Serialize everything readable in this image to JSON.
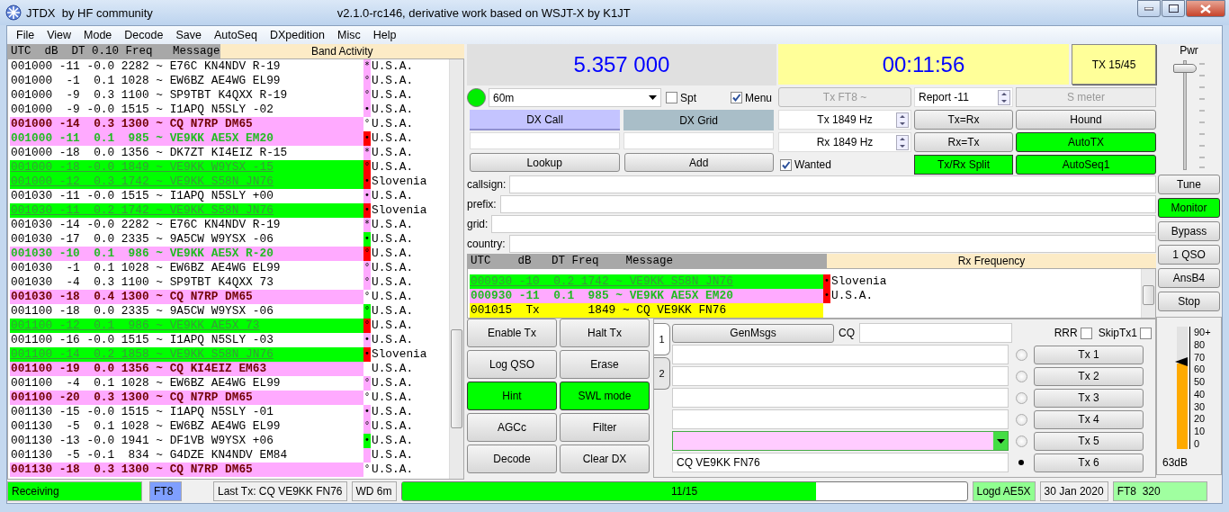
{
  "window": {
    "title": "JTDX  by HF community",
    "subtitle": "v2.1.0-rc146, derivative work based on WSJT-X by K1JT"
  },
  "menu": [
    "File",
    "View",
    "Mode",
    "Decode",
    "Save",
    "AutoSeq",
    "DXpedition",
    "Misc",
    "Help"
  ],
  "band_activity": {
    "header": "UTC  dB  DT 0.10 Freq   Message",
    "title": "Band Activity",
    "rows": [
      {
        "kind": "normal",
        "text": "001000 -11 -0.0 2282 ~ E76C KN4NDV R-19",
        "mark": "*",
        "color": "#ffaaff",
        "country": "U.S.A."
      },
      {
        "kind": "normal",
        "text": "001000  -1  0.1 1028 ~ EW6BZ AE4WG EL99",
        "mark": "°",
        "color": "#ffaaff",
        "country": "U.S.A."
      },
      {
        "kind": "normal",
        "text": "001000  -9  0.3 1100 ~ SP9TBT K4QXX R-19",
        "mark": "°",
        "color": "#ffaaff",
        "country": "U.S.A."
      },
      {
        "kind": "normal",
        "text": "001000  -9 -0.0 1515 ~ I1APQ N5SLY -02",
        "mark": "•",
        "color": "#ffaaff",
        "country": "U.S.A."
      },
      {
        "kind": "cq",
        "text": "001000 -14  0.3 1300 ~ CQ N7RP DM65",
        "mark": "°",
        "color": "#ffffff",
        "country": "U.S.A."
      },
      {
        "kind": "to_me",
        "text": "001000 -11  0.1  985 ~ VE9KK AE5X EM20",
        "mark": "•",
        "color": "#ff0000",
        "country": "U.S.A."
      },
      {
        "kind": "normal",
        "text": "001000 -18  0.0 1356 ~ DK7ZT KI4EIZ R-15",
        "mark": "*",
        "color": "#ffaaff",
        "country": "U.S.A."
      },
      {
        "kind": "worked",
        "text": "001000 -18 -0.0 1849 ~ VE9KK W9YSX -15",
        "mark": "°",
        "color": "#ff0000",
        "country": "U.S.A."
      },
      {
        "kind": "worked",
        "text": "001000 -12  0.3 1742 ~ VE9KK S58N JN76",
        "mark": "•",
        "color": "#ff0000",
        "country": "Slovenia"
      },
      {
        "kind": "normal",
        "text": "001030 -11 -0.0 1515 ~ I1APQ N5SLY +00",
        "mark": "•",
        "color": "#ffaaff",
        "country": "U.S.A."
      },
      {
        "kind": "worked",
        "text": "001030 -11  0.2 1742 ~ VE9KK S58N JN76",
        "mark": "•",
        "color": "#ff0000",
        "country": "Slovenia"
      },
      {
        "kind": "normal",
        "text": "001030 -14 -0.0 2282 ~ E76C KN4NDV R-19",
        "mark": "*",
        "color": "#ffaaff",
        "country": "U.S.A."
      },
      {
        "kind": "normal",
        "text": "001030 -17  0.0 2335 ~ 9A5CW W9YSX -06",
        "mark": "•",
        "color": "#00ff00",
        "country": "U.S.A."
      },
      {
        "kind": "to_me",
        "text": "001030 -10  0.1  986 ~ VE9KK AE5X R-20",
        "mark": "°",
        "color": "#ff0000",
        "country": "U.S.A."
      },
      {
        "kind": "normal",
        "text": "001030  -1  0.1 1028 ~ EW6BZ AE4WG EL99",
        "mark": "°",
        "color": "#ffaaff",
        "country": "U.S.A."
      },
      {
        "kind": "normal",
        "text": "001030  -4  0.3 1100 ~ SP9TBT K4QXX 73",
        "mark": "°",
        "color": "#ffaaff",
        "country": "U.S.A."
      },
      {
        "kind": "cq",
        "text": "001030 -18  0.4 1300 ~ CQ N7RP DM65",
        "mark": "°",
        "color": "#ffffff",
        "country": "U.S.A."
      },
      {
        "kind": "normal",
        "text": "001100 -18  0.0 2335 ~ 9A5CW W9YSX -06",
        "mark": "°",
        "color": "#00ff00",
        "country": "U.S.A."
      },
      {
        "kind": "worked",
        "text": "001100 -12  0.1  986 ~ VE9KK AE5X 73",
        "mark": "°",
        "color": "#ff0000",
        "country": "U.S.A."
      },
      {
        "kind": "normal",
        "text": "001100 -16 -0.0 1515 ~ I1APQ N5SLY -03",
        "mark": "•",
        "color": "#ffaaff",
        "country": "U.S.A."
      },
      {
        "kind": "worked",
        "text": "001100 -14  0.2 1858 ~ VE9KK S58N JN76",
        "mark": "•",
        "color": "#ff0000",
        "country": "Slovenia"
      },
      {
        "kind": "cq",
        "text": "001100 -19  0.0 1356 ~ CQ KI4EIZ EM63",
        "country": "U.S.A."
      },
      {
        "kind": "normal",
        "text": "001100  -4  0.1 1028 ~ EW6BZ AE4WG EL99",
        "mark": "°",
        "color": "#ffaaff",
        "country": "U.S.A."
      },
      {
        "kind": "cq",
        "text": "001100 -20  0.3 1300 ~ CQ N7RP DM65",
        "mark": "°",
        "color": "#ffffff",
        "country": "U.S.A."
      },
      {
        "kind": "normal",
        "text": "001130 -15 -0.0 1515 ~ I1APQ N5SLY -01",
        "mark": "•",
        "color": "#ffaaff",
        "country": "U.S.A."
      },
      {
        "kind": "normal",
        "text": "001130  -5  0.1 1028 ~ EW6BZ AE4WG EL99",
        "mark": "°",
        "color": "#ffaaff",
        "country": "U.S.A."
      },
      {
        "kind": "normal",
        "text": "001130 -13 -0.0 1941 ~ DF1VB W9YSX +06",
        "mark": "•",
        "color": "#00ff00",
        "country": "U.S.A."
      },
      {
        "kind": "normal",
        "text": "001130  -5 -0.1  834 ~ G4DZE KN4NDV EM84",
        "color": "#ffaaff",
        "country": "U.S.A."
      },
      {
        "kind": "cq",
        "text": "001130 -18  0.3 1300 ~ CQ N7RP DM65",
        "mark": "°",
        "color": "#ffffff",
        "country": "U.S.A."
      }
    ]
  },
  "frequency": "5.357 000",
  "clock": "00:11:56",
  "tx_period_button": "TX 15/45",
  "band_select": "60m",
  "spt": {
    "label": "Spt",
    "checked": false
  },
  "menu_toggle": {
    "label": "Menu",
    "checked": true
  },
  "dx_call": "DX Call",
  "dx_grid": "DX Grid",
  "lookup_button": "Lookup",
  "add_button": "Add",
  "wanted": {
    "label": "Wanted",
    "checked": true
  },
  "mode_button": {
    "label": "Tx FT8 ~",
    "disabled": true
  },
  "report": "Report -11",
  "s_meter": {
    "label": "S meter",
    "disabled": true
  },
  "tx_freq": "Tx  1849  Hz",
  "rx_freq": "Rx  1849  Hz",
  "control_buttons": [
    {
      "label": "Tx=Rx",
      "on": false
    },
    {
      "label": "Hound",
      "on": false
    },
    {
      "label": "Rx=Tx",
      "on": false
    },
    {
      "label": "AutoTX",
      "on": true
    },
    {
      "label": "Tx/Rx Split",
      "on": true
    },
    {
      "label": "AutoSeq1",
      "on": true
    }
  ],
  "lookup_fields": [
    {
      "label": "callsign:"
    },
    {
      "label": "prefix:"
    },
    {
      "label": "grid:"
    },
    {
      "label": "country:"
    }
  ],
  "power": {
    "label": "Pwr",
    "level": 0.96
  },
  "side_buttons": [
    {
      "label": "Tune",
      "on": false
    },
    {
      "label": "Monitor",
      "on": true
    },
    {
      "label": "Bypass",
      "on": false
    },
    {
      "label": "1 QSO",
      "on": false
    },
    {
      "label": "AnsB4",
      "on": false
    },
    {
      "label": "Stop",
      "on": false
    }
  ],
  "rx_frequency": {
    "header": "UTC    dB   DT Freq    Message",
    "title": "Rx Frequency",
    "rows": [
      {
        "kind": "worked",
        "text": "000930 -10  0.2 1742 ~ VE9KK S58N JN76",
        "mark": "•",
        "color": "#ff0000",
        "country": "Slovenia"
      },
      {
        "kind": "to_me",
        "text": "000930 -11  0.1  985 ~ VE9KK AE5X EM20",
        "mark": "•",
        "color": "#ff0000",
        "country": "U.S.A."
      },
      {
        "kind": "tx",
        "text": "001015  Tx       1849 ~ CQ VE9KK FN76"
      }
    ]
  },
  "action_buttons": [
    {
      "label": "Enable Tx",
      "on": false
    },
    {
      "label": "Halt Tx",
      "on": false
    },
    {
      "label": "Log QSO",
      "on": false
    },
    {
      "label": "Erase",
      "on": false
    },
    {
      "label": "Hint",
      "on": true
    },
    {
      "label": "SWL mode",
      "on": true
    },
    {
      "label": "AGCc",
      "on": false
    },
    {
      "label": "Filter",
      "on": false
    },
    {
      "label": "Decode",
      "on": false
    },
    {
      "label": "Clear DX",
      "on": false
    }
  ],
  "message_tabs": [
    {
      "label": "1",
      "selected": true
    },
    {
      "label": "2",
      "selected": false
    }
  ],
  "genmsgs_button": "GenMsgs",
  "cq_label": "CQ",
  "rrr": {
    "label": "RRR",
    "checked": false
  },
  "skip_tx1": {
    "label": "SkipTx1",
    "checked": false
  },
  "tx_messages": [
    {
      "kind": "field",
      "button": "Tx 1",
      "selected": false
    },
    {
      "kind": "field",
      "button": "Tx 2",
      "selected": false
    },
    {
      "kind": "field",
      "button": "Tx 3",
      "selected": false
    },
    {
      "kind": "field",
      "button": "Tx 4",
      "selected": false
    },
    {
      "kind": "combo",
      "button": "Tx 5",
      "selected": false
    },
    {
      "kind": "field",
      "value": "CQ VE9KK FN76",
      "button": "Tx 6",
      "selected": true
    }
  ],
  "signal_meter": {
    "ticks": [
      "90+",
      "80",
      "70",
      "60",
      "50",
      "40",
      "30",
      "20",
      "10",
      "0"
    ],
    "level": 0.7,
    "reading": "63dB"
  },
  "status_bar": {
    "state": "Receiving",
    "mode": "FT8",
    "last_tx": "Last Tx: CQ VE9KK FN76",
    "watchdog": "WD 6m",
    "progress": {
      "label": "11/15",
      "level": 0.733
    },
    "logged": "Logd AE5X",
    "date": "30 Jan 2020",
    "mode_info": "FT8  320"
  }
}
